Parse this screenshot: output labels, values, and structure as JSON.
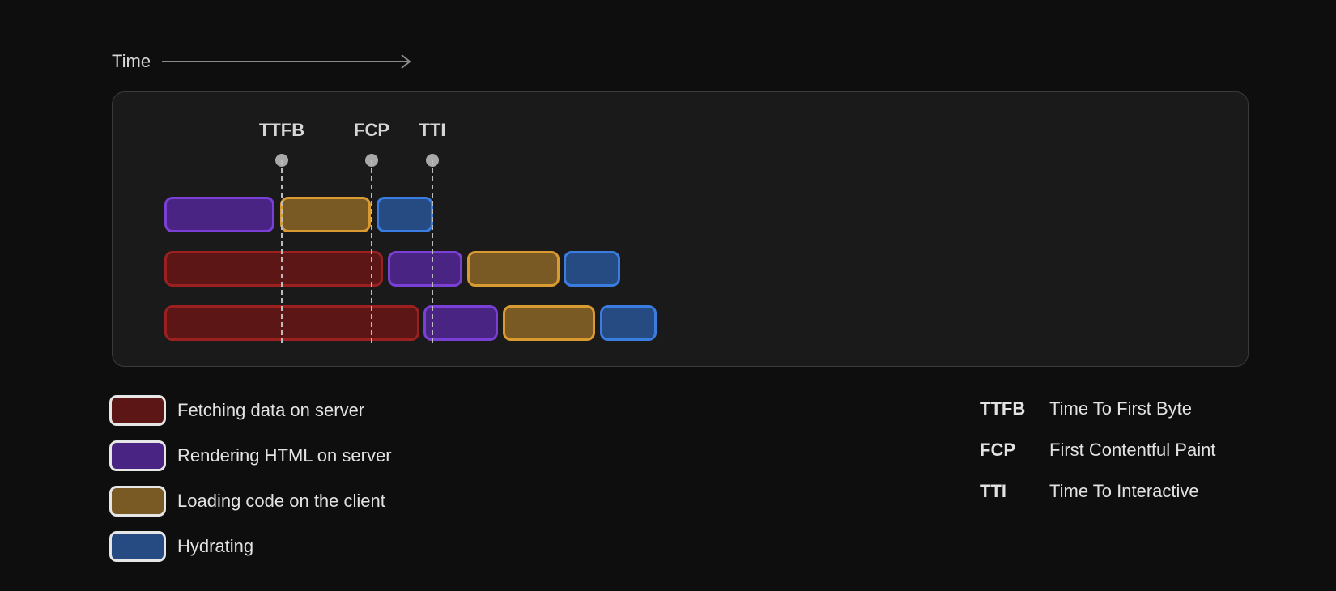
{
  "header": {
    "time_label": "Time"
  },
  "markers": [
    {
      "label": "TTFB"
    },
    {
      "label": "FCP"
    },
    {
      "label": "TTI"
    }
  ],
  "diagram_rows": [
    {
      "segments": [
        {
          "phase": "render"
        },
        {
          "phase": "load"
        },
        {
          "phase": "hydrate"
        }
      ]
    },
    {
      "segments": [
        {
          "phase": "fetch"
        },
        {
          "phase": "render"
        },
        {
          "phase": "load"
        },
        {
          "phase": "hydrate"
        }
      ]
    },
    {
      "segments": [
        {
          "phase": "fetch"
        },
        {
          "phase": "render"
        },
        {
          "phase": "load"
        },
        {
          "phase": "hydrate"
        }
      ]
    }
  ],
  "legend": [
    {
      "phase": "fetch",
      "label": "Fetching data on server"
    },
    {
      "phase": "render",
      "label": "Rendering HTML on server"
    },
    {
      "phase": "load",
      "label": "Loading code on the client"
    },
    {
      "phase": "hydrate",
      "label": "Hydrating"
    }
  ],
  "glossary": [
    {
      "abbr": "TTFB",
      "term": "Time To First Byte"
    },
    {
      "abbr": "FCP",
      "term": "First Contentful Paint"
    },
    {
      "abbr": "TTI",
      "term": "Time To Interactive"
    }
  ],
  "colors": {
    "fetch": "#9c2020",
    "render": "#7a3fd4",
    "load": "#d99a32",
    "hydrate": "#3a7de0",
    "background": "#0e0e0f",
    "panel": "#1a1a1b"
  }
}
